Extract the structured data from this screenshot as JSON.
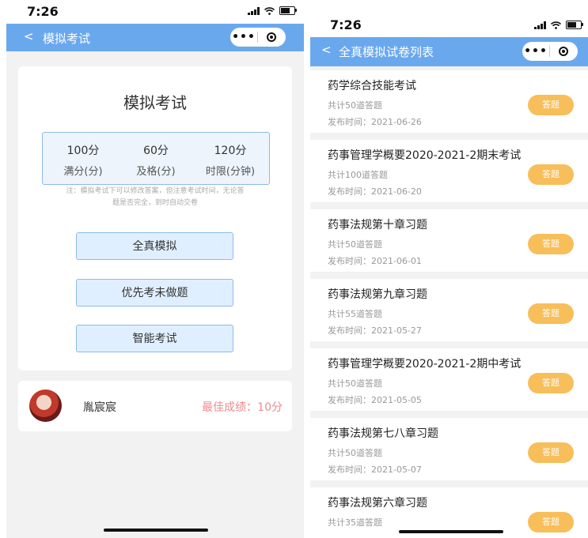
{
  "left": {
    "status_time": "7:26",
    "nav": {
      "back": "<",
      "title": "模拟考试",
      "more": "•••"
    },
    "exam": {
      "title": "模拟考试",
      "stats": [
        {
          "value": "100分",
          "label": "满分(分)"
        },
        {
          "value": "60分",
          "label": "及格(分)"
        },
        {
          "value": "120分",
          "label": "时限(分钟)"
        }
      ],
      "note_line1": "注：模拟考试下可以修改答案，但注意考试时间，无论答",
      "note_line2": "题是否完全，到时自动交卷",
      "buttons": [
        "全真模拟",
        "优先考未做题",
        "智能考试"
      ]
    },
    "user": {
      "name": "胤宸宸",
      "best_score": "最佳成绩：10分"
    }
  },
  "right": {
    "status_time": "7:26",
    "nav": {
      "back": "<",
      "title": "全真模拟试卷列表",
      "more": "•••"
    },
    "items": [
      {
        "title": "药学综合技能考试",
        "count": "共计50道答题",
        "date": "发布时间：2021-06-26",
        "button": "答题"
      },
      {
        "title": "药事管理学概要2020-2021-2期末考试",
        "count": "共计100道答题",
        "date": "发布时间：2021-06-20",
        "button": "答题"
      },
      {
        "title": "药事法规第十章习题",
        "count": "共计50道答题",
        "date": "发布时间：2021-06-01",
        "button": "答题"
      },
      {
        "title": "药事法规第九章习题",
        "count": "共计55道答题",
        "date": "发布时间：2021-05-27",
        "button": "答题"
      },
      {
        "title": "药事管理学概要2020-2021-2期中考试",
        "count": "共计50道答题",
        "date": "发布时间：2021-05-05",
        "button": "答题"
      },
      {
        "title": "药事法规第七八章习题",
        "count": "共计50道答题",
        "date": "发布时间：2021-05-07",
        "button": "答题"
      },
      {
        "title": "药事法规第六章习题",
        "count": "共计35道答题",
        "date": "",
        "button": "答题"
      }
    ]
  }
}
